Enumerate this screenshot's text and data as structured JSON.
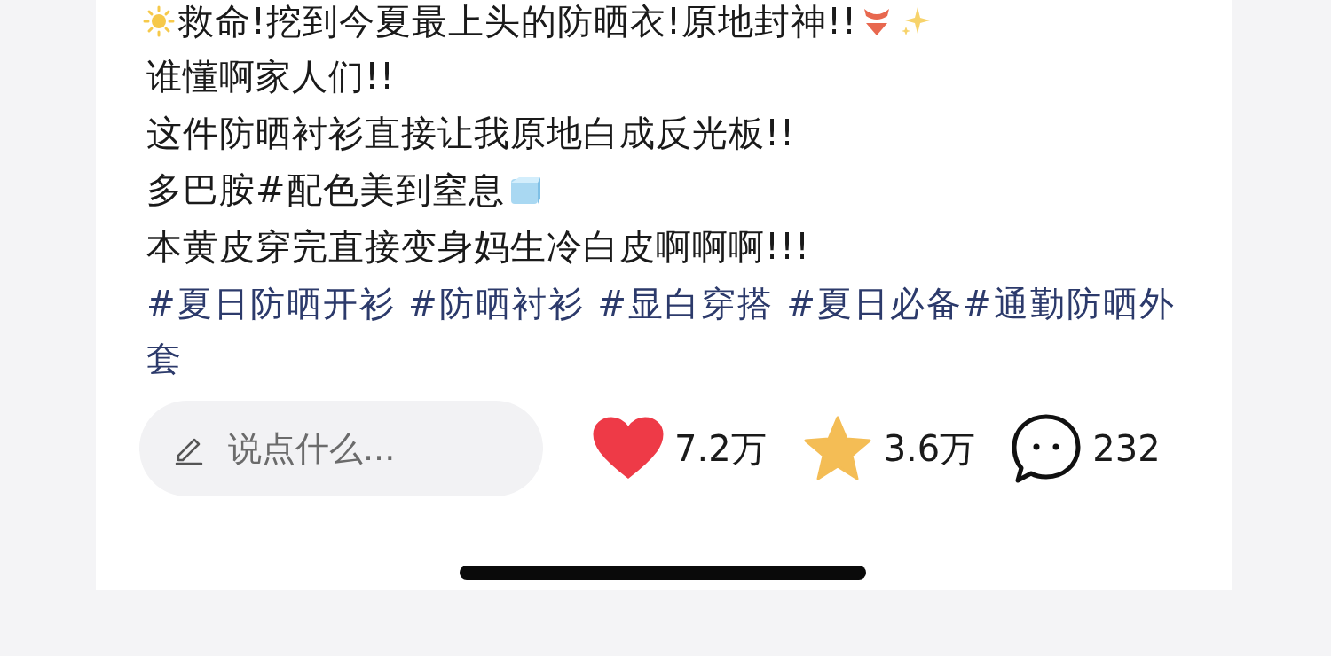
{
  "post": {
    "lines": [
      {
        "kind": "title",
        "text": "救命!挖到今夏最上头的防晒衣!原地封神!!"
      },
      {
        "kind": "plain",
        "text": "谁懂啊家人们!!"
      },
      {
        "kind": "plain",
        "text": "这件防晒衬衫直接让我原地白成反光板!!"
      },
      {
        "kind": "ice",
        "text": "多巴胺#配色美到窒息"
      },
      {
        "kind": "plain",
        "text": "本黄皮穿完直接变身妈生冷白皮啊啊啊!!!"
      }
    ],
    "hashtags": "#夏日防晒开衫 #防晒衬衫 #显白穿搭 #夏日必备#通勤防晒外套"
  },
  "action_bar": {
    "comment_field": {
      "placeholder": "说点什么..."
    },
    "like": {
      "count": "7.2万",
      "liked": true
    },
    "collect": {
      "count": "3.6万",
      "collected": true
    },
    "comments": {
      "count": "232"
    }
  }
}
